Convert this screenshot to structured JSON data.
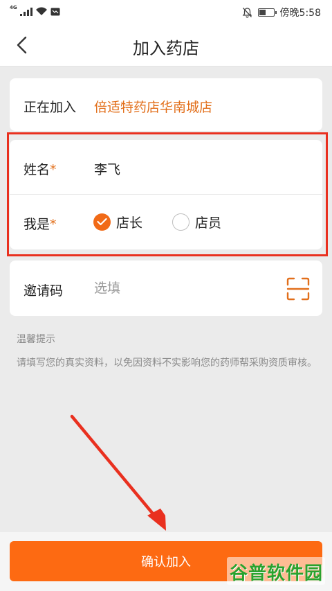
{
  "status_bar": {
    "network": "4G",
    "time": "傍晚5:58"
  },
  "header": {
    "title": "加入药店"
  },
  "join": {
    "label": "正在加入",
    "pharmacy": "倍适特药店华南城店"
  },
  "form": {
    "name_label": "姓名",
    "required_mark": "*",
    "name_value": "李飞",
    "role_label": "我是",
    "roles": [
      {
        "label": "店长",
        "selected": true
      },
      {
        "label": "店员",
        "selected": false
      }
    ]
  },
  "invite": {
    "label": "邀请码",
    "placeholder": "选填"
  },
  "tips": {
    "title": "温馨提示",
    "body": "请填写您的真实资料，以免因资料不实影响您的药师帮采购资质审核。"
  },
  "submit_label": "确认加入",
  "watermark": "谷普软件园",
  "colors": {
    "accent": "#fd6a12",
    "highlight": "#e9301f",
    "link_text": "#e26f1b"
  }
}
